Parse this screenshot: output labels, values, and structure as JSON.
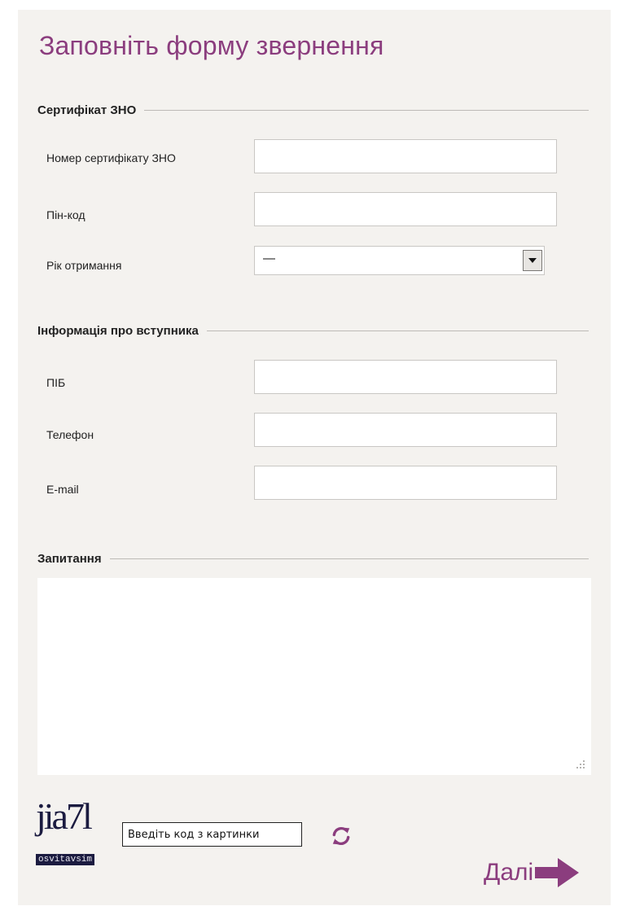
{
  "form": {
    "title": "Заповніть форму звернення"
  },
  "certificate_section": {
    "title": "Сертифікат ЗНО",
    "number_label": "Номер сертифікату ЗНО",
    "number_value": "",
    "pin_label": "Пін-код",
    "pin_value": "",
    "year_label": "Рік отримання",
    "year_selected": "—"
  },
  "applicant_section": {
    "title": "Інформація про вступника",
    "name_label": "ПІБ",
    "name_value": "",
    "phone_label": "Телефон",
    "phone_value": "",
    "email_label": "E-mail",
    "email_value": ""
  },
  "question_section": {
    "title": "Запитання",
    "question_value": ""
  },
  "captcha": {
    "image_text": "jia7l",
    "image_caption": "osvitavsim",
    "input_placeholder": "Введіть код з картинки",
    "input_value": "",
    "refresh_icon": "refresh-icon"
  },
  "actions": {
    "next_label": "Далі",
    "next_icon": "arrow-right-icon"
  },
  "colors": {
    "accent": "#8b3d7e",
    "panel_background": "#f4f2ef"
  }
}
